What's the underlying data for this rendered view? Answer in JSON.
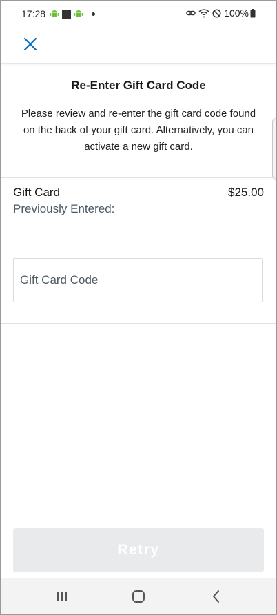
{
  "status_bar": {
    "time": "17:28",
    "battery": "100%"
  },
  "icons": {
    "close": "close-icon",
    "recents": "recents-icon",
    "home": "home-icon",
    "back": "back-icon"
  },
  "colors": {
    "accent": "#0a6ebd",
    "retry_disabled_bg": "#e8eaec",
    "secondary_text": "#4a5a66"
  },
  "dialog": {
    "title": "Re-Enter Gift Card Code",
    "description": "Please review and re-enter the gift card code found on the back of your gift card. Alternatively, you can activate a new gift card."
  },
  "gift_card": {
    "label": "Gift Card",
    "amount": "$25.00",
    "previously_entered": "Previously Entered:"
  },
  "code_input": {
    "placeholder": "Gift Card Code",
    "value": ""
  },
  "retry": {
    "label": "Retry"
  }
}
